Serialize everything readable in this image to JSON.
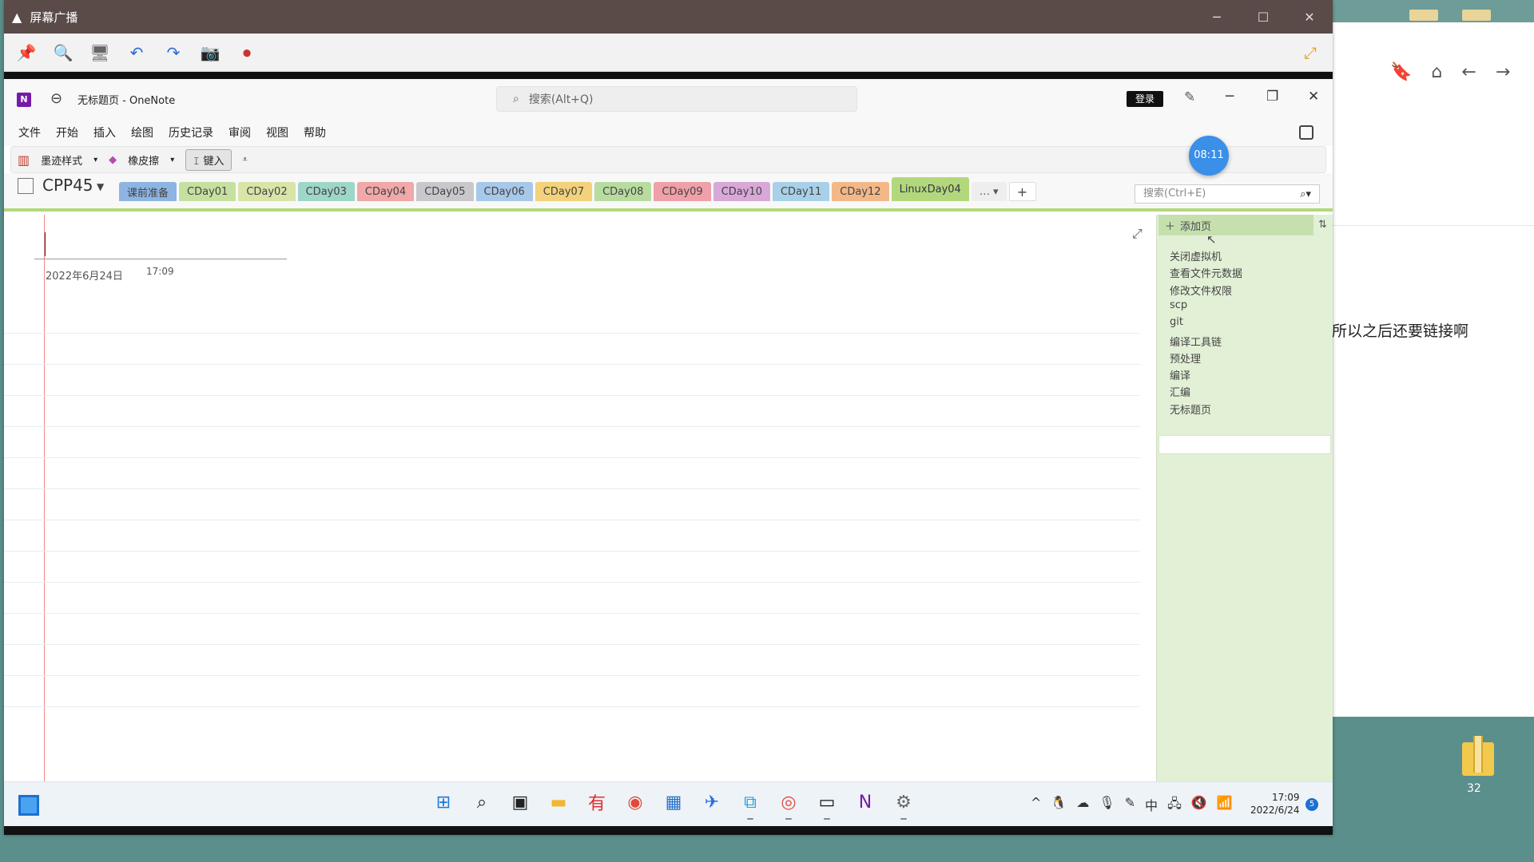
{
  "desktop": {
    "chat_text": "所以之后还要链接啊",
    "folder_label": "32",
    "nav_icons": [
      "bookmark-icon",
      "home-icon",
      "back-arrow-icon",
      "forward-arrow-icon"
    ]
  },
  "recorder": {
    "title": "屏幕广播",
    "controls": {
      "minimize": "─",
      "maximize": "☐",
      "close": "✕"
    },
    "toolbar_icons": [
      "pin-icon",
      "zoom-icon",
      "monitor-icon",
      "undo-icon",
      "redo-icon",
      "camera-icon",
      "record-screen-icon"
    ],
    "fullscreen_icon": "fullscreen-icon"
  },
  "onenote": {
    "title": "无标题页  -  OneNote",
    "search_placeholder": "搜索(Alt+Q)",
    "login": "登录",
    "menu": [
      "文件",
      "开始",
      "插入",
      "绘图",
      "历史记录",
      "审阅",
      "视图",
      "帮助"
    ],
    "ribbon": {
      "ink_style": "墨迹样式",
      "eraser": "橡皮擦",
      "type": "键入"
    },
    "timer": "08:11",
    "notebook": "CPP45",
    "tabs": [
      {
        "label": "课前准备",
        "color": "#8db4e2"
      },
      {
        "label": "CDay01",
        "color": "#c6e0a0"
      },
      {
        "label": "CDay02",
        "color": "#d8e4a8"
      },
      {
        "label": "CDay03",
        "color": "#9ed6c8"
      },
      {
        "label": "CDay04",
        "color": "#f0a8a8"
      },
      {
        "label": "CDay05",
        "color": "#c8c8cc"
      },
      {
        "label": "CDay06",
        "color": "#a8c8e8"
      },
      {
        "label": "CDay07",
        "color": "#f2d27a"
      },
      {
        "label": "CDay08",
        "color": "#b8dca0"
      },
      {
        "label": "CDay09",
        "color": "#f0a0a8"
      },
      {
        "label": "CDay10",
        "color": "#d8a8d8"
      },
      {
        "label": "CDay11",
        "color": "#a8d0e8"
      },
      {
        "label": "CDay12",
        "color": "#f2b888"
      },
      {
        "label": "LinuxDay04",
        "color": "#b3d87c"
      }
    ],
    "more_tabs": "…",
    "add_tab": "+",
    "section_search_placeholder": "搜索(Ctrl+E)",
    "page": {
      "date": "2022年6月24日",
      "time": "17:09"
    },
    "add_page": "添加页",
    "pages": [
      "关闭虚拟机",
      "查看文件元数据",
      "修改文件权限",
      "scp",
      "git",
      "编译工具链",
      "预处理",
      "编译",
      "汇编",
      "无标题页"
    ],
    "selected_page": "无标题页"
  },
  "taskbar": {
    "apps": [
      {
        "name": "start-button",
        "glyph": "⊞",
        "color": "#1e78d7",
        "state": ""
      },
      {
        "name": "search-icon",
        "glyph": "⌕",
        "color": "#222",
        "state": ""
      },
      {
        "name": "task-view-icon",
        "glyph": "▣",
        "color": "#222",
        "state": ""
      },
      {
        "name": "file-explorer-icon",
        "glyph": "▬",
        "color": "#f2b632",
        "state": ""
      },
      {
        "name": "youdao-icon",
        "glyph": "有",
        "color": "#e42b2b",
        "state": ""
      },
      {
        "name": "chrome-icon",
        "glyph": "◉",
        "color": "#e04a3a",
        "state": ""
      },
      {
        "name": "store-icon",
        "glyph": "▦",
        "color": "#2673c8",
        "state": ""
      },
      {
        "name": "feishu-icon",
        "glyph": "✈",
        "color": "#2d6bdc",
        "state": ""
      },
      {
        "name": "remote-desktop-icon",
        "glyph": "⧉",
        "color": "#1ea1e0",
        "state": "run"
      },
      {
        "name": "snail-app-icon",
        "glyph": "◎",
        "color": "#e44b3c",
        "state": "run"
      },
      {
        "name": "terminal-icon",
        "glyph": "▭",
        "color": "#111",
        "state": "run"
      },
      {
        "name": "onenote-icon",
        "glyph": "N",
        "color": "#7719aa",
        "state": "active"
      },
      {
        "name": "settings-icon",
        "glyph": "⚙",
        "color": "#666",
        "state": "run"
      }
    ],
    "tray": [
      "^",
      "🐧",
      "☁",
      "🎙",
      "✎",
      "中",
      "🖧",
      "🔇",
      "📶"
    ],
    "time": "17:09",
    "date": "2022/6/24",
    "notifications": "5"
  }
}
